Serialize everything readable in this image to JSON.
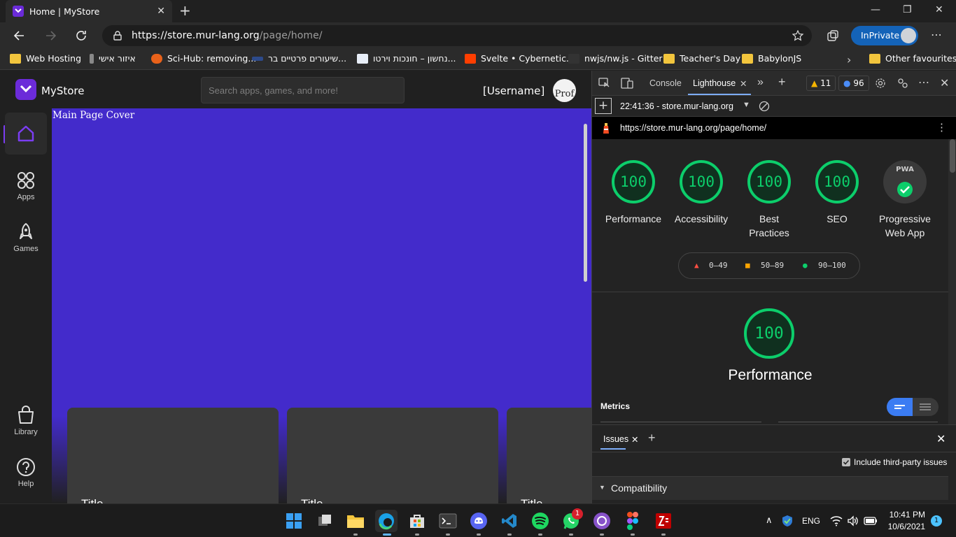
{
  "browser": {
    "tab_title": "Home | MyStore",
    "url_host": "https://store.mur-lang.org",
    "url_path": "/page/home/",
    "inprivate_label": "InPrivate",
    "bookmarks": [
      "Web Hosting",
      "איזור אישי",
      "Sci-Hub: removing...",
      "שיעורים פרטיים בר...",
      "נחשון – חונכות וירטו...",
      "Svelte • Cybernetic...",
      "nwjs/nw.js - Gitter",
      "Teacher's Day",
      "BabylonJS"
    ],
    "other_favourites": "Other favourites"
  },
  "app": {
    "brand": "MyStore",
    "search_placeholder": "Search apps, games, and more!",
    "username": "[Username]",
    "profile_alt": "Prof",
    "cover_alt": "Main Page Cover",
    "sidebar": [
      {
        "label": "",
        "icon": "home-icon"
      },
      {
        "label": "Apps",
        "icon": "apps-icon"
      },
      {
        "label": "Games",
        "icon": "rocket-icon"
      },
      {
        "label": "Library",
        "icon": "shopping-bag-icon"
      },
      {
        "label": "Help",
        "icon": "help-icon"
      }
    ],
    "cards": [
      "Title",
      "Title",
      "Title"
    ],
    "accent": "#432bcb"
  },
  "devtools": {
    "tabs": [
      "Console",
      "Lighthouse"
    ],
    "warnings": "11",
    "messages": "96",
    "report_time": "22:41:36 - store.mur-lang.org",
    "report_url": "https://store.mur-lang.org/page/home/",
    "scores": [
      {
        "label": "Performance",
        "value": "100"
      },
      {
        "label": "Accessibility",
        "value": "100"
      },
      {
        "label": "Best Practices",
        "value": "100"
      },
      {
        "label": "SEO",
        "value": "100"
      }
    ],
    "pwa_label": "Progressive Web App",
    "pwa_badge": "PWA",
    "legend": [
      "0–49",
      "50–89",
      "90–100"
    ],
    "perf_score": "100",
    "perf_title": "Performance",
    "metrics_label": "Metrics",
    "drawer_tab": "Issues",
    "third_party": "Include third-party issues",
    "compat": "Compatibility",
    "pass_color": "#0cce6b"
  },
  "taskbar": {
    "lang": "ENG",
    "time": "10:41 PM",
    "date": "10/6/2021",
    "notif": "1",
    "whatsapp_badge": "1"
  }
}
